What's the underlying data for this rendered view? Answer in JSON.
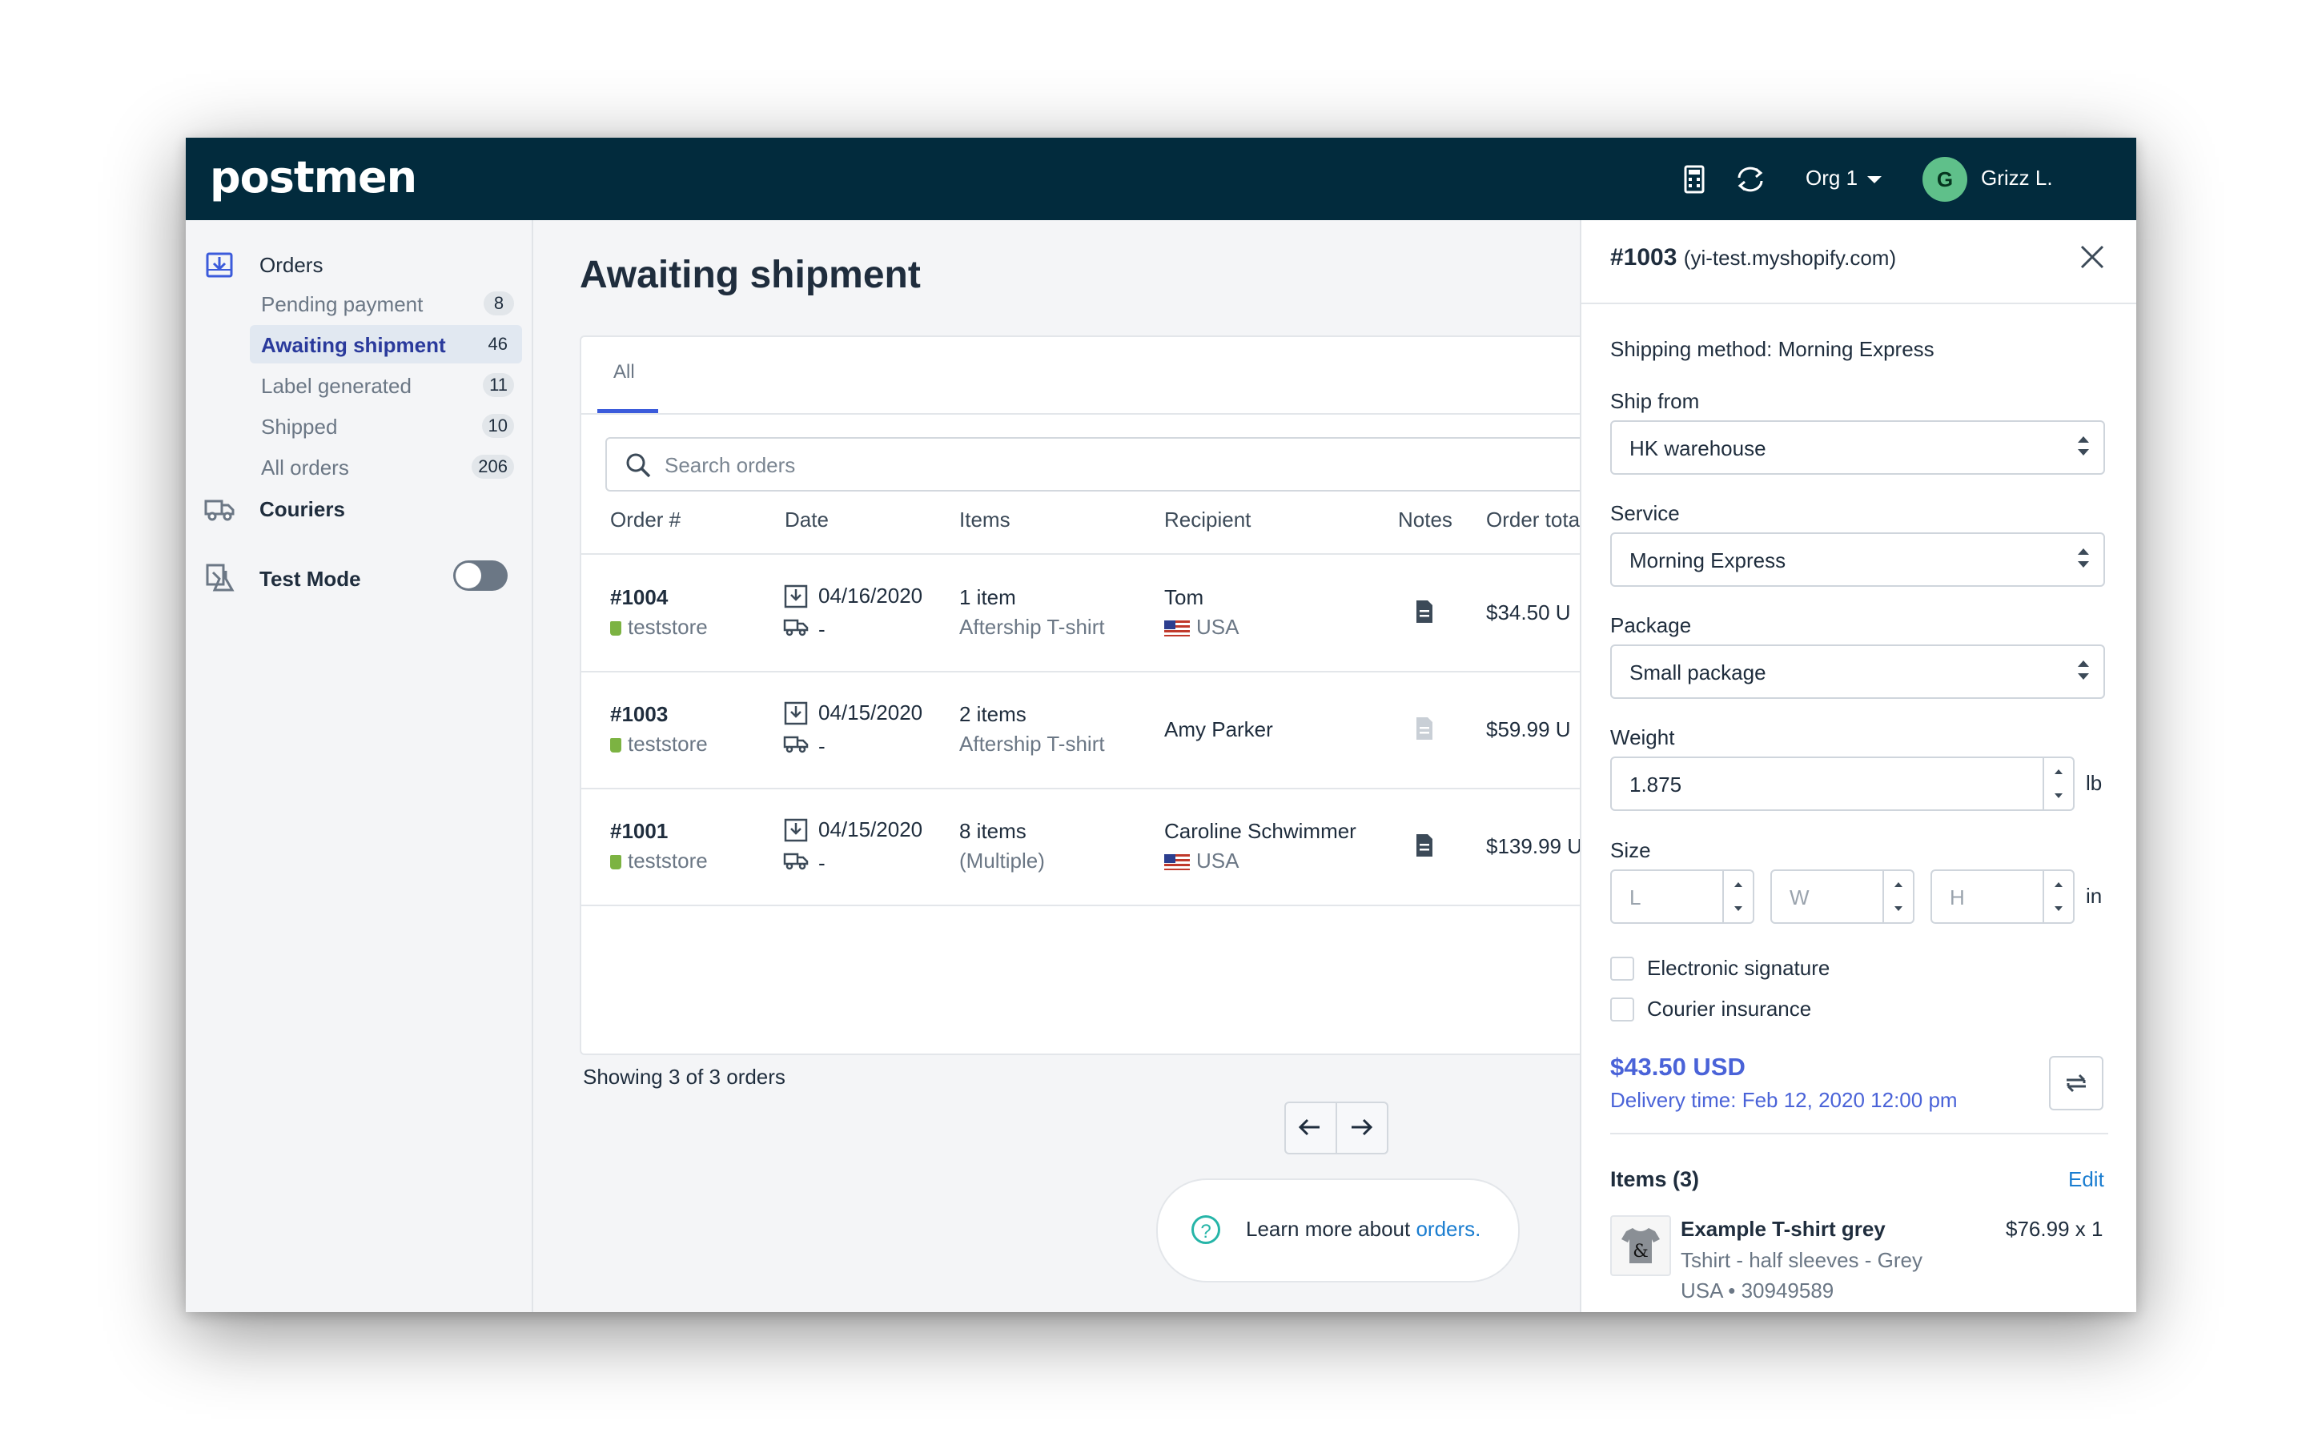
{
  "app": {
    "logo": "postmen",
    "org": "Org 1",
    "user_initial": "G",
    "user_name": "Grizz L."
  },
  "sidebar": {
    "orders_label": "Orders",
    "items": [
      {
        "label": "Pending payment",
        "count": "8"
      },
      {
        "label": "Awaiting shipment",
        "count": "46"
      },
      {
        "label": "Label generated",
        "count": "11"
      },
      {
        "label": "Shipped",
        "count": "10"
      },
      {
        "label": "All orders",
        "count": "206"
      }
    ],
    "couriers_label": "Couriers",
    "test_mode_label": "Test Mode",
    "test_mode_on": false
  },
  "main": {
    "title": "Awaiting shipment",
    "tab": "All",
    "search_placeholder": "Search orders",
    "columns": [
      "Order #",
      "Date",
      "Items",
      "Recipient",
      "Notes",
      "Order tota"
    ],
    "rows": [
      {
        "order": "#1004",
        "store": "teststore",
        "date": "04/16/2020",
        "ship": "-",
        "items": "1 item",
        "items_sub": "Aftership T-shirt",
        "recipient": "Tom",
        "country": "USA",
        "total": "$34.50 U"
      },
      {
        "order": "#1003",
        "store": "teststore",
        "date": "04/15/2020",
        "ship": "-",
        "items": "2 items",
        "items_sub": "Aftership T-shirt",
        "recipient": "Amy Parker",
        "country": "",
        "total": "$59.99 U"
      },
      {
        "order": "#1001",
        "store": "teststore",
        "date": "04/15/2020",
        "ship": "-",
        "items": "8 items",
        "items_sub": "(Multiple)",
        "recipient": "Caroline Schwimmer",
        "country": "USA",
        "total": "$139.99 U"
      }
    ],
    "showing": "Showing 3 of 3 orders",
    "learn_prefix": "Learn more about ",
    "learn_link": "orders."
  },
  "panel": {
    "order_no": "#1003",
    "order_store": "(yi-test.myshopify.com)",
    "shipping_method": "Shipping method: Morning Express",
    "ship_from_label": "Ship from",
    "ship_from_value": "HK warehouse",
    "service_label": "Service",
    "service_value": "Morning Express",
    "package_label": "Package",
    "package_value": "Small package",
    "weight_label": "Weight",
    "weight_value": "1.875",
    "weight_unit": "lb",
    "size_label": "Size",
    "size_l": "L",
    "size_w": "W",
    "size_h": "H",
    "size_unit": "in",
    "electronic_signature": "Electronic signature",
    "courier_insurance": "Courier insurance",
    "price": "$43.50 USD",
    "delivery": "Delivery time: Feb 12, 2020 12:00 pm",
    "items_header": "Items (3)",
    "edit_label": "Edit",
    "item_name": "Example T-shirt grey",
    "item_price": "$76.99 x 1",
    "item_desc": "Tshirt - half sleeves - Grey",
    "item_meta": "USA • 30949589"
  },
  "colors": {
    "topbar": "#022b3d",
    "accent": "#4a63d8",
    "link": "#1a7dd0",
    "active_nav": "#2a3a9c"
  }
}
